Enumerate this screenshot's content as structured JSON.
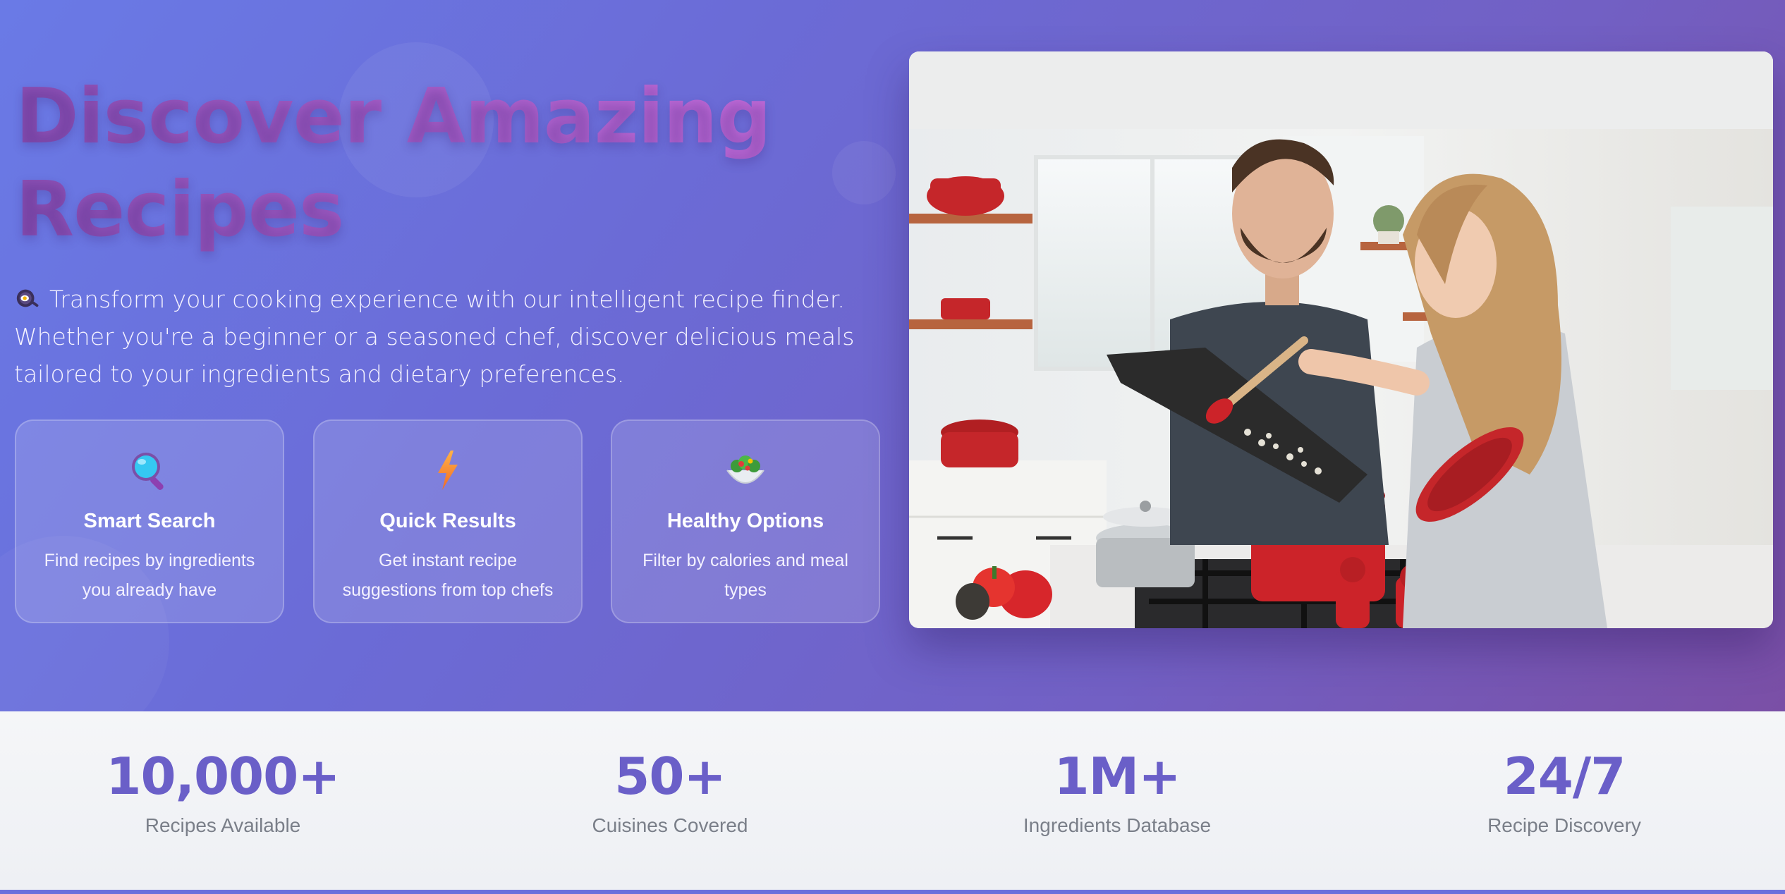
{
  "hero": {
    "title_line1": "Discover Amazing",
    "title_line2": "Recipes",
    "description": "Transform your cooking experience with our intelligent recipe finder. Whether you're a beginner or a seasoned chef, discover delicious meals tailored to your ingredients and dietary preferences.",
    "description_icon": "cooking-pan-icon",
    "photo_alt": "Couple cooking together in a bright kitchen"
  },
  "features": [
    {
      "icon": "magnifying-glass-icon",
      "title": "Smart Search",
      "description": "Find recipes by ingredients you already have"
    },
    {
      "icon": "lightning-icon",
      "title": "Quick Results",
      "description": "Get instant recipe suggestions from top chefs"
    },
    {
      "icon": "salad-bowl-icon",
      "title": "Healthy Options",
      "description": "Filter by calories and meal types"
    }
  ],
  "stats": [
    {
      "value": "10,000+",
      "label": "Recipes Available"
    },
    {
      "value": "50+",
      "label": "Cuisines Covered"
    },
    {
      "value": "1M+",
      "label": "Ingredients Database"
    },
    {
      "value": "24/7",
      "label": "Recipe Discovery"
    }
  ],
  "colors": {
    "hero_gradient_start": "#6a7ae6",
    "hero_gradient_end": "#7a4fa6",
    "title_gradient": "#a85fc9",
    "stat_number": "#6a5fc8",
    "stat_label": "#7a7f89"
  }
}
